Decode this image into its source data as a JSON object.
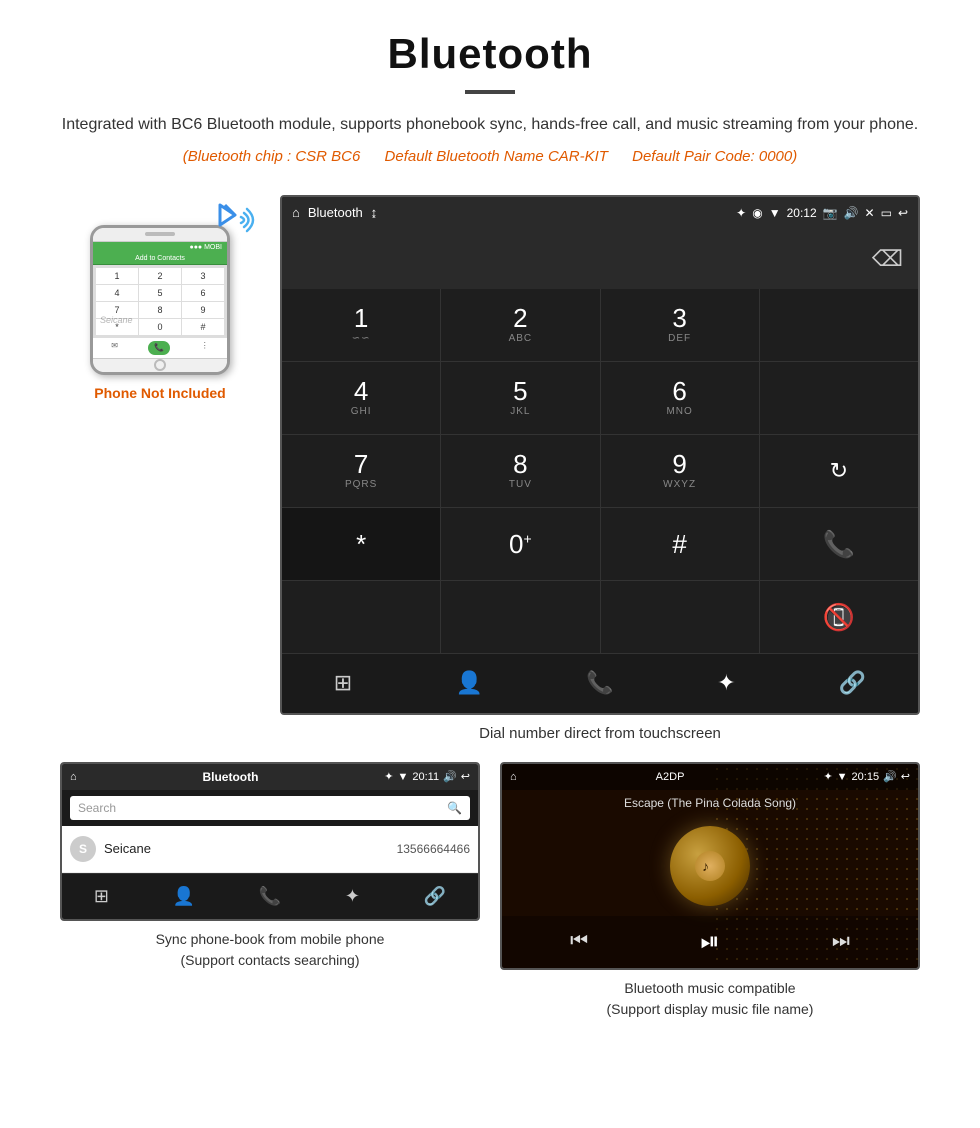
{
  "page": {
    "title": "Bluetooth",
    "description": "Integrated with BC6 Bluetooth module, supports phonebook sync, hands-free call, and music streaming from your phone.",
    "specs": {
      "chip": "(Bluetooth chip : CSR BC6",
      "name": "Default Bluetooth Name CAR-KIT",
      "code": "Default Pair Code: 0000)"
    },
    "dial_caption": "Dial number direct from touchscreen",
    "phonebook_caption_line1": "Sync phone-book from mobile phone",
    "phonebook_caption_line2": "(Support contacts searching)",
    "music_caption_line1": "Bluetooth music compatible",
    "music_caption_line2": "(Support display music file name)"
  },
  "phone_label": "Phone Not Included",
  "watermark": "Seicane",
  "dial_screen": {
    "status_left_icon": "⌂",
    "status_center": "Bluetooth",
    "status_usb": "↨",
    "status_time": "20:12",
    "status_icons_right": "✦ ● ▼",
    "keys": [
      {
        "num": "1",
        "sub": "∽∽"
      },
      {
        "num": "2",
        "sub": "ABC"
      },
      {
        "num": "3",
        "sub": "DEF"
      },
      {
        "num": "",
        "sub": "",
        "type": "empty"
      },
      {
        "num": "4",
        "sub": "GHI"
      },
      {
        "num": "5",
        "sub": "JKL"
      },
      {
        "num": "6",
        "sub": "MNO"
      },
      {
        "num": "",
        "sub": "",
        "type": "empty"
      },
      {
        "num": "7",
        "sub": "PQRS"
      },
      {
        "num": "8",
        "sub": "TUV"
      },
      {
        "num": "9",
        "sub": "WXYZ"
      },
      {
        "num": "↻",
        "sub": "",
        "type": "icon"
      },
      {
        "num": "*",
        "sub": "",
        "type": "dark"
      },
      {
        "num": "0",
        "sub": "+"
      },
      {
        "num": "#",
        "sub": ""
      },
      {
        "num": "📞",
        "sub": "",
        "type": "green-call"
      },
      {
        "num": "",
        "sub": "",
        "type": "empty"
      },
      {
        "num": "",
        "sub": "",
        "type": "empty"
      },
      {
        "num": "",
        "sub": "",
        "type": "empty"
      },
      {
        "num": "📵",
        "sub": "",
        "type": "red-call"
      }
    ],
    "bottom_icons": [
      "⊞",
      "👤",
      "📞",
      "✦",
      "🔗"
    ]
  },
  "phonebook_screen": {
    "status_center": "Bluetooth",
    "status_time": "20:11",
    "search_placeholder": "Search",
    "contact": {
      "initial": "S",
      "name": "Seicane",
      "number": "13566664466"
    },
    "bottom_icons": [
      "⊞",
      "👤",
      "📞",
      "✦",
      "🔗"
    ]
  },
  "music_screen": {
    "status_center": "A2DP",
    "status_time": "20:15",
    "song_title": "Escape (The Pina Colada Song)",
    "controls": [
      "⏮",
      "⏯",
      "⏭"
    ]
  }
}
